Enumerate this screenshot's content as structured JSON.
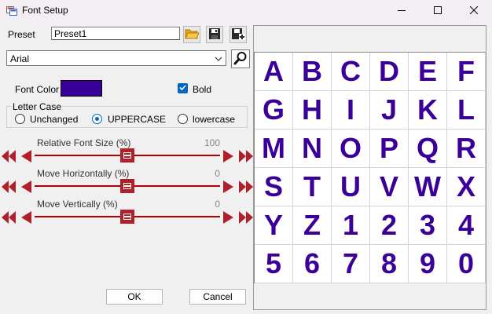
{
  "window": {
    "title": "Font Setup"
  },
  "preset": {
    "label": "Preset",
    "value": "Preset1",
    "icons": [
      "open-folder-icon",
      "save-icon",
      "save-as-icon"
    ]
  },
  "font": {
    "selected": "Arial",
    "search_icon": "magnifier-icon"
  },
  "font_color": {
    "label": "Font Color",
    "value": "#3a0099"
  },
  "bold": {
    "label": "Bold",
    "checked": true
  },
  "letter_case": {
    "legend": "Letter Case",
    "options": [
      {
        "label": "Unchanged",
        "selected": false
      },
      {
        "label": "UPPERCASE",
        "selected": true
      },
      {
        "label": "lowercase",
        "selected": false
      }
    ]
  },
  "sliders": [
    {
      "label": "Relative Font Size (%)",
      "value": "100",
      "level": 0.5
    },
    {
      "label": "Move Horizontally (%)",
      "value": "0",
      "level": 0.5
    },
    {
      "label": "Move Vertically (%)",
      "value": "0",
      "level": 0.5
    }
  ],
  "buttons": {
    "ok": "OK",
    "cancel": "Cancel"
  },
  "preview": {
    "glyphs": [
      "A",
      "B",
      "C",
      "D",
      "E",
      "F",
      "G",
      "H",
      "I",
      "J",
      "K",
      "L",
      "M",
      "N",
      "O",
      "P",
      "Q",
      "R",
      "S",
      "T",
      "U",
      "V",
      "W",
      "X",
      "Y",
      "Z",
      "1",
      "2",
      "3",
      "4",
      "5",
      "6",
      "7",
      "8",
      "9",
      "0"
    ],
    "glyph_color": "#3a0099"
  },
  "colors": {
    "slider_accent": "#b0202a",
    "checkbox_accent": "#0067c0"
  }
}
